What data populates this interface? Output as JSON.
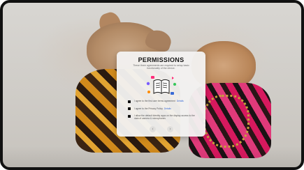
{
  "modal": {
    "title": "PERMISSIONS",
    "subtitle": "These three agreements are required to setup basic functionality of the device.",
    "items": [
      {
        "label": "I agree to the first user terms agreement",
        "link": "Details"
      },
      {
        "label": "I agree to the Privacy Policy",
        "link": "Details"
      },
      {
        "label": "I allow the default Identity apps on the display access to the data of camera & microphones",
        "link": ""
      }
    ],
    "nav": {
      "prev": "‹",
      "next": "›"
    }
  },
  "colors": {
    "accent_pink": "#ff2d7a",
    "accent_blue": "#3a6bd6",
    "accent_orange": "#ff8a00",
    "accent_green": "#34c759",
    "accent_purple": "#7a5cff"
  },
  "icons": {
    "illustration": "book-with-floating-icons",
    "prev": "chevron-left-icon",
    "next": "chevron-right-icon"
  }
}
